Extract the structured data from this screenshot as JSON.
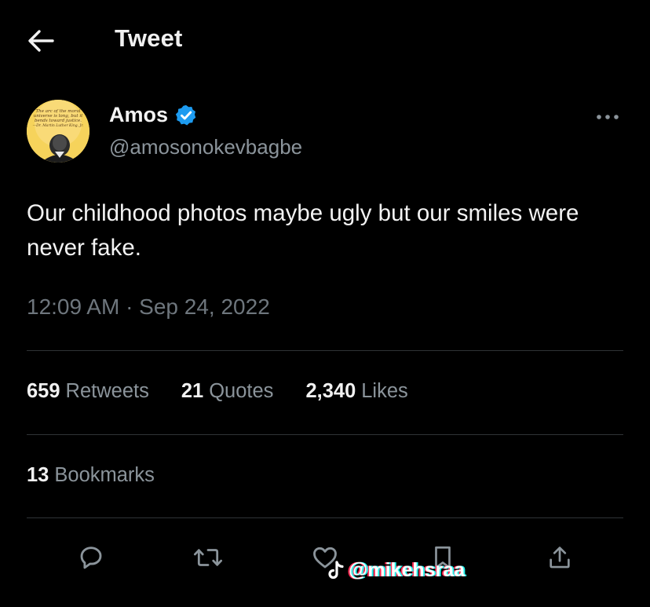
{
  "header": {
    "title": "Tweet",
    "back_icon": "arrow-left-icon"
  },
  "author": {
    "name": "Amos",
    "handle": "@amosonokevbagbe",
    "verified": true,
    "verified_color": "#1d9bf0",
    "avatar_quote": "The arc of the moral universe is long, but it bends toward justice. —Dr. Martin Luther King, Jr."
  },
  "tweet": {
    "text": "Our childhood photos maybe ugly but our smiles were never fake.",
    "timestamp": "12:09 AM · Sep 24, 2022"
  },
  "stats": {
    "retweets": {
      "count": "659",
      "label": "Retweets"
    },
    "quotes": {
      "count": "21",
      "label": "Quotes"
    },
    "likes": {
      "count": "2,340",
      "label": "Likes"
    },
    "bookmarks": {
      "count": "13",
      "label": "Bookmarks"
    }
  },
  "actions": [
    "reply-icon",
    "retweet-icon",
    "like-icon",
    "bookmark-icon",
    "share-icon"
  ],
  "watermark": {
    "text": "@mikehsraa"
  },
  "colors": {
    "background": "#000000",
    "text_primary": "#e7e9ea",
    "text_secondary": "#71767b",
    "divider": "#2f3336",
    "accent": "#1d9bf0"
  }
}
